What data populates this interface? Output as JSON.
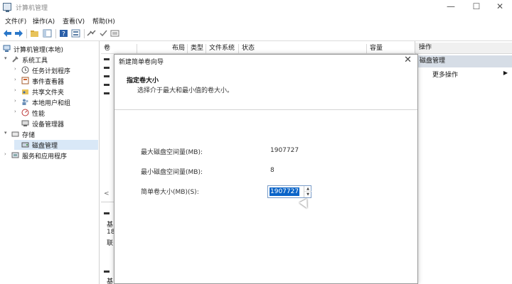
{
  "window": {
    "title": "计算机管理",
    "minimize": "—",
    "maximize": "☐",
    "close": "✕"
  },
  "menu": [
    "文件(F)",
    "操作(A)",
    "查看(V)",
    "帮助(H)"
  ],
  "tree": {
    "root": "计算机管理(本地)",
    "system_tools": "系统工具",
    "task_scheduler": "任务计划程序",
    "event_viewer": "事件查看器",
    "shared_folders": "共享文件夹",
    "local_users": "本地用户和组",
    "performance": "性能",
    "device_manager": "设备管理器",
    "storage": "存储",
    "disk_management": "磁盘管理",
    "services_apps": "服务和应用程序"
  },
  "columns": {
    "volume": "卷",
    "layout": "布局",
    "type": "类型",
    "filesystem": "文件系统",
    "status": "状态",
    "capacity": "容量"
  },
  "lower": {
    "line1": "基",
    "line2": "18",
    "line3": "联",
    "line4": "基"
  },
  "actions": {
    "header": "操作",
    "section": "磁盘管理",
    "more": "更多操作",
    "arrow": "▶"
  },
  "wizard": {
    "title": "新建简单卷向导",
    "close": "✕",
    "step_title": "指定卷大小",
    "step_subtitle": "选择介于最大和最小值的卷大小。",
    "max_label": "最大磁盘空间量(MB):",
    "max_value": "1907727",
    "min_label": "最小磁盘空间量(MB):",
    "min_value": "8",
    "size_label": "简单卷大小(MB)(S):",
    "size_value": "1907727"
  },
  "icons": {
    "arrow-up": "▲",
    "arrow-down": "▼",
    "expand": "▾",
    "collapse": "›",
    "scroll-left": "<"
  }
}
